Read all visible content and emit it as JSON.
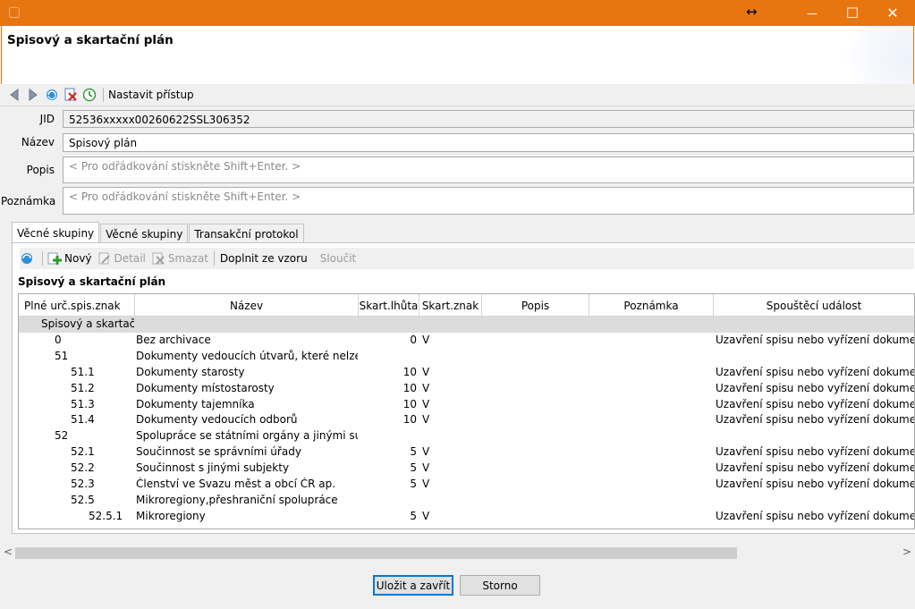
{
  "window": {
    "resize_glyph": "↔",
    "minimize_glyph": "—",
    "maximize_glyph": "☐",
    "close_glyph": "✕",
    "accent": "#e87610"
  },
  "header": {
    "title": "Spisový a skartační plán"
  },
  "toolbar": {
    "icons": [
      "back-icon",
      "forward-icon",
      "refresh-icon",
      "delete-icon",
      "history-icon"
    ],
    "access_label": "Nastavit přístup"
  },
  "form": {
    "jid_label": "JID",
    "jid_value": "52536xxxxx00260622SSL306352",
    "name_label": "Název",
    "name_value": "Spisový plán",
    "desc_label": "Popis",
    "desc_placeholder": "< Pro odřádkování stiskněte Shift+Enter. >",
    "note_label": "Poznámka",
    "note_placeholder": "< Pro odřádkování stiskněte Shift+Enter. >"
  },
  "tabs": [
    {
      "label": "Věcné skupiny",
      "active": true
    },
    {
      "label": "Věcné skupiny",
      "active": false
    },
    {
      "label": "Transakční protokol",
      "active": false
    }
  ],
  "subtoolbar": {
    "new_label": "Nový",
    "detail_label": "Detail",
    "delete_label": "Smazat",
    "fill_label": "Doplnit ze vzoru",
    "merge_label": "Sloučit"
  },
  "panel": {
    "caption": "Spisový a skartační plán"
  },
  "grid": {
    "columns": [
      "Plné urč.spis.znak",
      "Název",
      "Skart.lhůta",
      "Skart.znak",
      "Popis",
      "Poznámka",
      "Spouštěcí událost"
    ],
    "group": "Spisový a skartační plán",
    "rows": [
      {
        "code": "0",
        "level": 0,
        "name": "Bez archivace",
        "lhuta": "0",
        "znak": "V",
        "event": "Uzavření spisu nebo vyřízení dokumentu"
      },
      {
        "code": "51",
        "level": 0,
        "name": "Dokumenty vedoucích útvarů, které nelze zařadit",
        "lhuta": "",
        "znak": "",
        "event": ""
      },
      {
        "code": "51.1",
        "level": 1,
        "name": "Dokumenty starosty",
        "lhuta": "10",
        "znak": "V",
        "event": "Uzavření spisu nebo vyřízení dokumentu"
      },
      {
        "code": "51.2",
        "level": 1,
        "name": "Dokumenty místostarosty",
        "lhuta": "10",
        "znak": "V",
        "event": "Uzavření spisu nebo vyřízení dokumentu"
      },
      {
        "code": "51.3",
        "level": 1,
        "name": "Dokumenty tajemníka",
        "lhuta": "10",
        "znak": "V",
        "event": "Uzavření spisu nebo vyřízení dokumentu"
      },
      {
        "code": "51.4",
        "level": 1,
        "name": "Dokumenty vedoucích odborů",
        "lhuta": "10",
        "znak": "V",
        "event": "Uzavření spisu nebo vyřízení dokumentu"
      },
      {
        "code": "52",
        "level": 0,
        "name": "Spolupráce se státními orgány a jinými subjekty",
        "lhuta": "",
        "znak": "",
        "event": ""
      },
      {
        "code": "52.1",
        "level": 1,
        "name": "Součinnost se správními úřady",
        "lhuta": "5",
        "znak": "V",
        "event": "Uzavření spisu nebo vyřízení dokumentu"
      },
      {
        "code": "52.2",
        "level": 1,
        "name": "Součinnost s jinými subjekty",
        "lhuta": "5",
        "znak": "V",
        "event": "Uzavření spisu nebo vyřízení dokumentu"
      },
      {
        "code": "52.3",
        "level": 1,
        "name": "Členství ve Svazu měst a obcí ČR ap.",
        "lhuta": "5",
        "znak": "V",
        "event": "Uzavření spisu nebo vyřízení dokumentu"
      },
      {
        "code": "52.5",
        "level": 1,
        "name": "Mikroregiony,přeshraniční spolupráce",
        "lhuta": "",
        "znak": "",
        "event": ""
      },
      {
        "code": "52.5.1",
        "level": 2,
        "name": "Mikroregiony",
        "lhuta": "5",
        "znak": "V",
        "event": "Uzavření spisu nebo vyřízení dokumentu"
      }
    ]
  },
  "scroll": {
    "left_glyph": "<",
    "right_glyph": ">"
  },
  "footer": {
    "save_label": "Uložit a zavřít",
    "cancel_label": "Storno"
  }
}
